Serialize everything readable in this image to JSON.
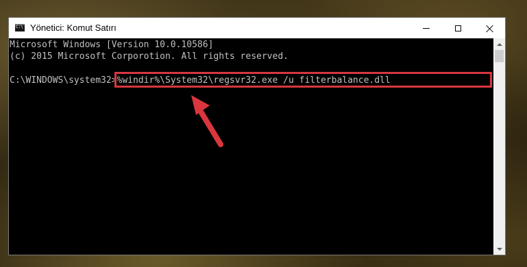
{
  "window": {
    "title": "Yönetici: Komut Satırı",
    "icon": "console-icon",
    "controls": {
      "minimize": "minimize-icon",
      "maximize": "maximize-icon",
      "close": "close-icon"
    }
  },
  "console": {
    "lines": [
      "Microsoft Windows [Version 10.0.10586]",
      "(c) 2015 Microsoft Corporotion. All rights reserved."
    ],
    "prompt": "C:\\WINDOWS\\system32>",
    "command": "%windir%\\System32\\regsvr32.exe /u filterbalance.dll"
  },
  "colors": {
    "console_bg": "#000000",
    "console_text": "#c0c0c0",
    "highlight": "#d9363e"
  }
}
